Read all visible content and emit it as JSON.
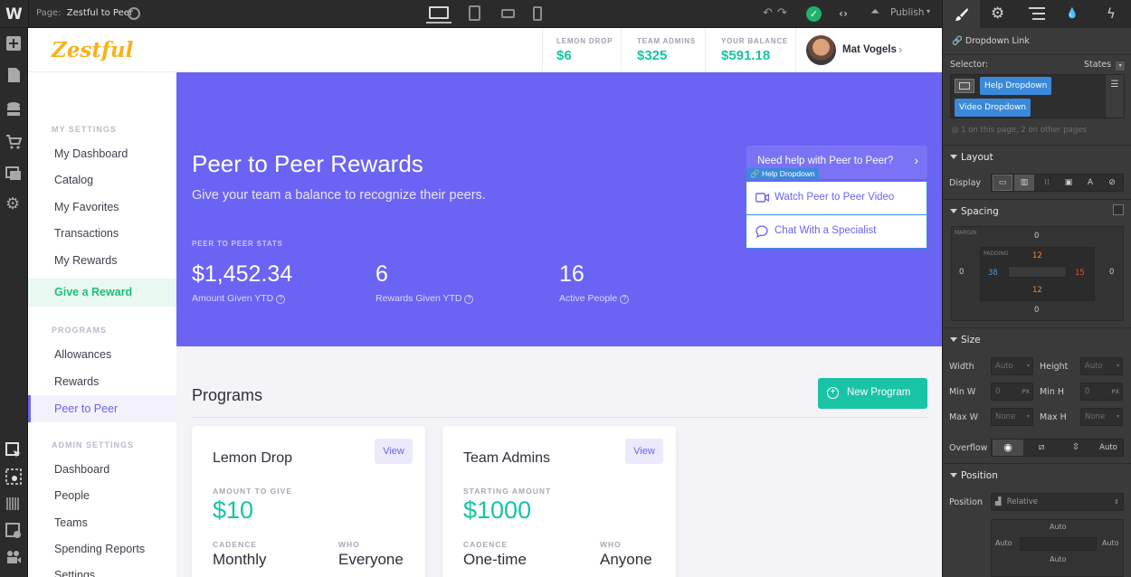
{
  "topbar": {
    "page_prefix": "Page:",
    "page_name": "Zestful to Peer",
    "publish_label": "Publish",
    "devices": [
      "desktop",
      "tablet",
      "mobile-landscape",
      "mobile-portrait"
    ]
  },
  "app": {
    "logo": "Zestful",
    "header_stats": [
      {
        "label": "LEMON DROP",
        "value": "$6"
      },
      {
        "label": "TEAM ADMINS",
        "value": "$325"
      },
      {
        "label": "YOUR BALANCE",
        "value": "$591.18"
      }
    ],
    "user_name": "Mat Vogels"
  },
  "sidebar": {
    "my_settings": "MY SETTINGS",
    "my_items": [
      "My Dashboard",
      "Catalog",
      "My Favorites",
      "Transactions",
      "My Rewards"
    ],
    "give_reward": "Give a Reward",
    "programs": "PROGRAMS",
    "program_items": [
      "Allowances",
      "Rewards",
      "Peer to Peer"
    ],
    "admin_settings": "ADMIN SETTINGS",
    "admin_items": [
      "Dashboard",
      "People",
      "Teams",
      "Spending Reports",
      "Settings"
    ]
  },
  "hero": {
    "title": "Peer to Peer Rewards",
    "subtitle": "Give your team a balance to recognize their peers.",
    "stats_label": "PEER TO PEER STATS",
    "stats": [
      {
        "value": "$1,452.34",
        "label": "Amount Given YTD"
      },
      {
        "value": "6",
        "label": "Rewards Given YTD"
      },
      {
        "value": "16",
        "label": "Active People"
      }
    ],
    "help_button": "Need help with Peer to Peer?",
    "help_tag": "Help Dropdown",
    "dropdown_items": [
      "Watch Peer to Peer Video",
      "Chat With a Specialist"
    ]
  },
  "programs": {
    "heading": "Programs",
    "new_button": "New Program",
    "cards": [
      {
        "title": "Lemon Drop",
        "view": "View",
        "amount_label": "AMOUNT TO GIVE",
        "amount": "$10",
        "cadence_label": "CADENCE",
        "cadence": "Monthly",
        "who_label": "WHO",
        "who": "Everyone"
      },
      {
        "title": "Team Admins",
        "view": "View",
        "amount_label": "STARTING AMOUNT",
        "amount": "$1000",
        "cadence_label": "CADENCE",
        "cadence": "One-time",
        "who_label": "WHO",
        "who": "Anyone"
      }
    ]
  },
  "panel": {
    "element_name": "Dropdown Link",
    "selector_label": "Selector:",
    "states_label": "States",
    "selectors": [
      "Help Dropdown",
      "Video Dropdown"
    ],
    "selector_note": "1 on this page, 2 on other pages",
    "layout": "Layout",
    "display_label": "Display",
    "spacing": "Spacing",
    "margin_label": "MARGIN",
    "padding_label": "PADDING",
    "margin": {
      "top": "0",
      "right": "0",
      "bottom": "0",
      "left": "0"
    },
    "padding": {
      "top": "12",
      "right": "15",
      "bottom": "12",
      "left": "38"
    },
    "size": "Size",
    "width_label": "Width",
    "width_value": "Auto",
    "height_label": "Height",
    "height_value": "Auto",
    "minw_label": "Min W",
    "minw_value": "0",
    "minw_unit": "PX",
    "minh_label": "Min H",
    "minh_value": "0",
    "minh_unit": "PX",
    "maxw_label": "Max W",
    "maxw_value": "None",
    "maxh_label": "Max H",
    "maxh_value": "None",
    "overflow_label": "Overflow",
    "overflow_auto": "Auto",
    "position": "Position",
    "position_label": "Position",
    "position_value": "Relative",
    "pos_values": {
      "top": "Auto",
      "left": "Auto",
      "right": "Auto",
      "bottom": "Auto"
    }
  },
  "colors": {
    "accent": "#6b63f4",
    "teal": "#19c3a6",
    "green": "#20bf7a",
    "publish_check": "#1fb36b",
    "selector_blue": "#3a8ad9"
  }
}
